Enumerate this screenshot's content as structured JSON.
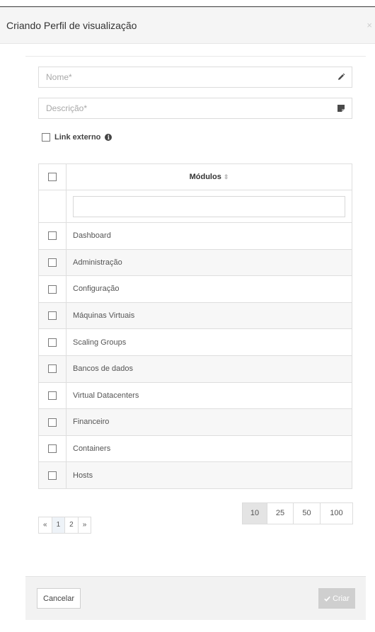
{
  "modal": {
    "title": "Criando Perfil de visualização",
    "close_symbol": "×"
  },
  "form": {
    "name_placeholder": "Nome*",
    "name_icon": "pencil-icon",
    "description_placeholder": "Descrição*",
    "description_icon": "note-icon",
    "link_externo_label": "Link externo",
    "info_icon": "info-icon"
  },
  "table": {
    "header": "Módulos",
    "sort_icon": "⇕",
    "filter_value": "",
    "rows": [
      "Dashboard",
      "Administração",
      "Configuração",
      "Máquinas Virtuais",
      "Scaling Groups",
      "Bancos de dados",
      "Virtual Datacenters",
      "Financeiro",
      "Containers",
      "Hosts"
    ]
  },
  "pagination": {
    "prev": "«",
    "pages": [
      "1",
      "2"
    ],
    "next": "»",
    "active_page": "1"
  },
  "page_sizes": {
    "options": [
      "10",
      "25",
      "50",
      "100"
    ],
    "selected": "10"
  },
  "footer": {
    "cancel_label": "Cancelar",
    "create_label": "Criar",
    "create_icon": "check-icon"
  },
  "colors": {
    "disabled_button": "#cfcfcf",
    "header_bg": "#f5f5f5"
  }
}
